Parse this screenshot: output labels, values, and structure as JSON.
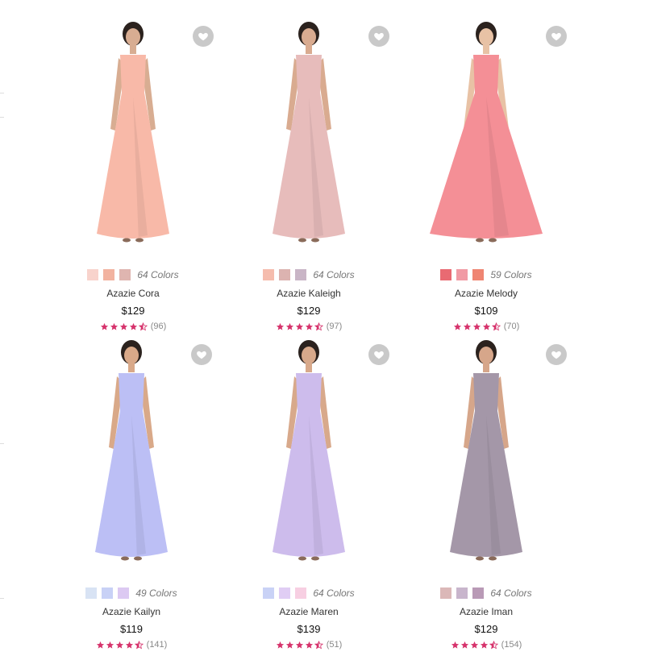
{
  "icons": {
    "favorite": "heart-icon",
    "star": "star-icon",
    "half_star": "half-star-icon"
  },
  "colors": {
    "rating_star": "#d6336c",
    "fav_bg": "#c9c9c9"
  },
  "products": [
    {
      "name": "Azazie Cora",
      "price": "$129",
      "colors_label": "64 Colors",
      "rating": 4.5,
      "reviews": "(96)",
      "swatches": [
        "#f8d3cc",
        "#f2b3a0",
        "#dfb5b0"
      ],
      "dress_color": "#f8b9a8",
      "skin": "#d8ad92"
    },
    {
      "name": "Azazie Kaleigh",
      "price": "$129",
      "colors_label": "64 Colors",
      "rating": 4.5,
      "reviews": "(97)",
      "swatches": [
        "#f5bcad",
        "#dcb3b0",
        "#c9b5c6"
      ],
      "dress_color": "#e7bcbb",
      "skin": "#d9ab90"
    },
    {
      "name": "Azazie Melody",
      "price": "$109",
      "colors_label": "59 Colors",
      "rating": 4.5,
      "reviews": "(70)",
      "swatches": [
        "#e96a72",
        "#f19aa4",
        "#ef8572"
      ],
      "dress_color": "#f48f96",
      "skin": "#e8c2a5"
    },
    {
      "name": "Azazie Kailyn",
      "price": "$119",
      "colors_label": "49 Colors",
      "rating": 4.5,
      "reviews": "(141)",
      "swatches": [
        "#d8e3f4",
        "#c8d1f6",
        "#dcc9f2"
      ],
      "dress_color": "#bcbff5",
      "skin": "#d9a989"
    },
    {
      "name": "Azazie Maren",
      "price": "$139",
      "colors_label": "64 Colors",
      "rating": 4.5,
      "reviews": "(51)",
      "swatches": [
        "#c9d2f6",
        "#e0cdf4",
        "#f7cfe2"
      ],
      "dress_color": "#cdbcec",
      "skin": "#d8a98b"
    },
    {
      "name": "Azazie Iman",
      "price": "$129",
      "colors_label": "64 Colors",
      "rating": 4.5,
      "reviews": "(154)",
      "swatches": [
        "#dbb8b8",
        "#c8b5cc",
        "#b99ab6"
      ],
      "dress_color": "#a497a8",
      "skin": "#d6a68a"
    }
  ]
}
